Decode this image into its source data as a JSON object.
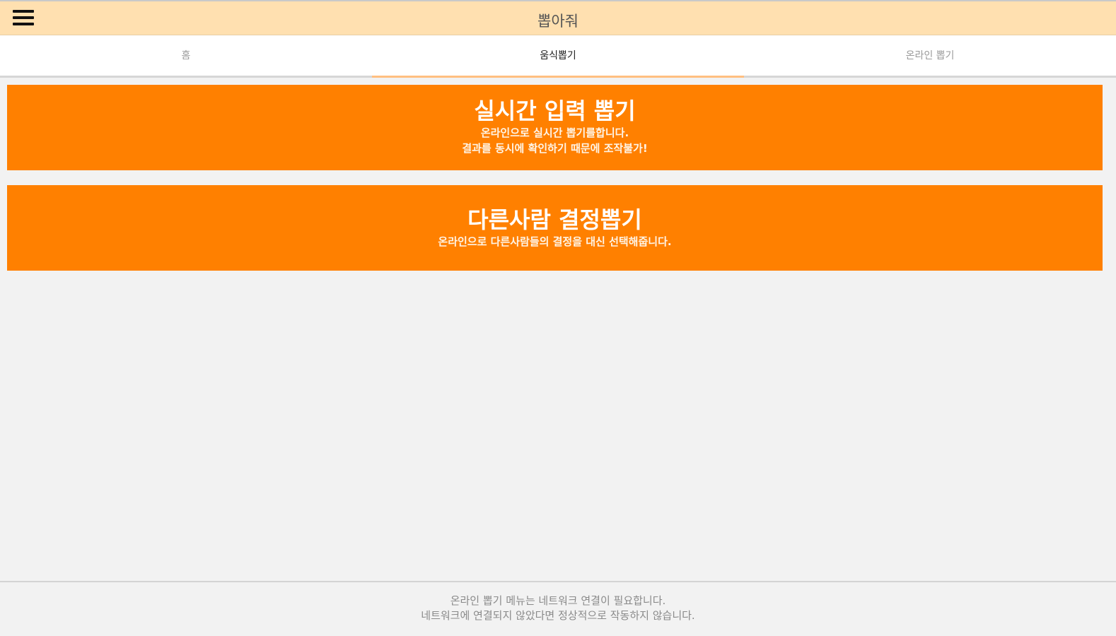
{
  "appbar": {
    "title": "뽑아줘",
    "menu_icon": "hamburger-menu-icon"
  },
  "tabs": [
    {
      "label": "홈",
      "active": false
    },
    {
      "label": "움식뽑기",
      "active": true
    },
    {
      "label": "온라인 뽑기",
      "active": false
    }
  ],
  "cards": [
    {
      "title": "실시간 입력 뽑기",
      "desc_lines": [
        "온라인으로 실시간 뽑기를합니다.",
        "결과를 동시에 확인하기 때문에 조작불가!"
      ]
    },
    {
      "title": "다른사람 결정뽑기",
      "desc_lines": [
        "온라인으로 다른사람들의 결정을 대신 선택해줍니다."
      ]
    }
  ],
  "footer": {
    "lines": [
      "온라인 뽑기 메뉴는 네트워크 연결이 필요합니다.",
      "네트워크에 연결되지 않았다면 정상적으로 작동하지 않습니다."
    ]
  },
  "colors": {
    "appbar_bg": "#ffe0b0",
    "card_bg": "#ff8000",
    "tab_indicator": "#ffbf80",
    "page_bg": "#f2f2f2"
  }
}
